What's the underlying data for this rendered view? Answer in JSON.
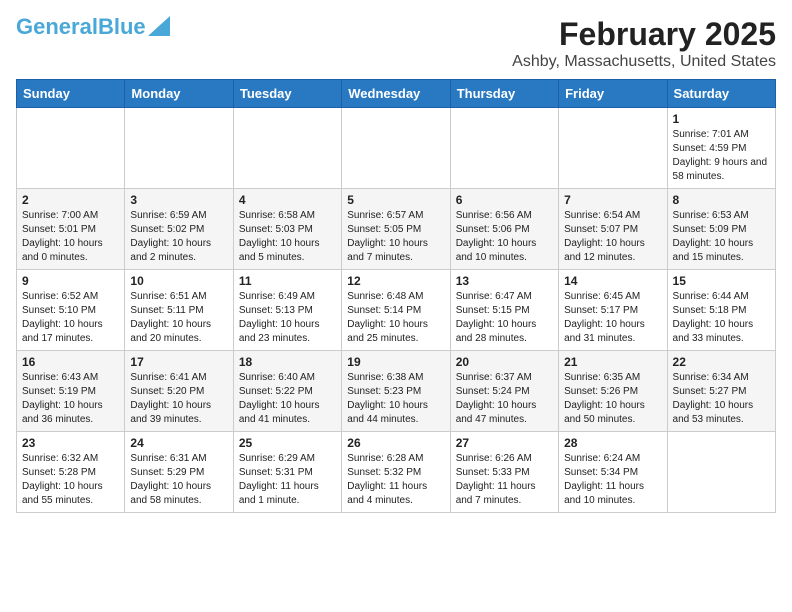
{
  "header": {
    "logo_line1": "General",
    "logo_line2": "Blue",
    "title": "February 2025",
    "subtitle": "Ashby, Massachusetts, United States"
  },
  "weekdays": [
    "Sunday",
    "Monday",
    "Tuesday",
    "Wednesday",
    "Thursday",
    "Friday",
    "Saturday"
  ],
  "weeks": [
    [
      {
        "day": "",
        "info": ""
      },
      {
        "day": "",
        "info": ""
      },
      {
        "day": "",
        "info": ""
      },
      {
        "day": "",
        "info": ""
      },
      {
        "day": "",
        "info": ""
      },
      {
        "day": "",
        "info": ""
      },
      {
        "day": "1",
        "info": "Sunrise: 7:01 AM\nSunset: 4:59 PM\nDaylight: 9 hours and 58 minutes."
      }
    ],
    [
      {
        "day": "2",
        "info": "Sunrise: 7:00 AM\nSunset: 5:01 PM\nDaylight: 10 hours and 0 minutes."
      },
      {
        "day": "3",
        "info": "Sunrise: 6:59 AM\nSunset: 5:02 PM\nDaylight: 10 hours and 2 minutes."
      },
      {
        "day": "4",
        "info": "Sunrise: 6:58 AM\nSunset: 5:03 PM\nDaylight: 10 hours and 5 minutes."
      },
      {
        "day": "5",
        "info": "Sunrise: 6:57 AM\nSunset: 5:05 PM\nDaylight: 10 hours and 7 minutes."
      },
      {
        "day": "6",
        "info": "Sunrise: 6:56 AM\nSunset: 5:06 PM\nDaylight: 10 hours and 10 minutes."
      },
      {
        "day": "7",
        "info": "Sunrise: 6:54 AM\nSunset: 5:07 PM\nDaylight: 10 hours and 12 minutes."
      },
      {
        "day": "8",
        "info": "Sunrise: 6:53 AM\nSunset: 5:09 PM\nDaylight: 10 hours and 15 minutes."
      }
    ],
    [
      {
        "day": "9",
        "info": "Sunrise: 6:52 AM\nSunset: 5:10 PM\nDaylight: 10 hours and 17 minutes."
      },
      {
        "day": "10",
        "info": "Sunrise: 6:51 AM\nSunset: 5:11 PM\nDaylight: 10 hours and 20 minutes."
      },
      {
        "day": "11",
        "info": "Sunrise: 6:49 AM\nSunset: 5:13 PM\nDaylight: 10 hours and 23 minutes."
      },
      {
        "day": "12",
        "info": "Sunrise: 6:48 AM\nSunset: 5:14 PM\nDaylight: 10 hours and 25 minutes."
      },
      {
        "day": "13",
        "info": "Sunrise: 6:47 AM\nSunset: 5:15 PM\nDaylight: 10 hours and 28 minutes."
      },
      {
        "day": "14",
        "info": "Sunrise: 6:45 AM\nSunset: 5:17 PM\nDaylight: 10 hours and 31 minutes."
      },
      {
        "day": "15",
        "info": "Sunrise: 6:44 AM\nSunset: 5:18 PM\nDaylight: 10 hours and 33 minutes."
      }
    ],
    [
      {
        "day": "16",
        "info": "Sunrise: 6:43 AM\nSunset: 5:19 PM\nDaylight: 10 hours and 36 minutes."
      },
      {
        "day": "17",
        "info": "Sunrise: 6:41 AM\nSunset: 5:20 PM\nDaylight: 10 hours and 39 minutes."
      },
      {
        "day": "18",
        "info": "Sunrise: 6:40 AM\nSunset: 5:22 PM\nDaylight: 10 hours and 41 minutes."
      },
      {
        "day": "19",
        "info": "Sunrise: 6:38 AM\nSunset: 5:23 PM\nDaylight: 10 hours and 44 minutes."
      },
      {
        "day": "20",
        "info": "Sunrise: 6:37 AM\nSunset: 5:24 PM\nDaylight: 10 hours and 47 minutes."
      },
      {
        "day": "21",
        "info": "Sunrise: 6:35 AM\nSunset: 5:26 PM\nDaylight: 10 hours and 50 minutes."
      },
      {
        "day": "22",
        "info": "Sunrise: 6:34 AM\nSunset: 5:27 PM\nDaylight: 10 hours and 53 minutes."
      }
    ],
    [
      {
        "day": "23",
        "info": "Sunrise: 6:32 AM\nSunset: 5:28 PM\nDaylight: 10 hours and 55 minutes."
      },
      {
        "day": "24",
        "info": "Sunrise: 6:31 AM\nSunset: 5:29 PM\nDaylight: 10 hours and 58 minutes."
      },
      {
        "day": "25",
        "info": "Sunrise: 6:29 AM\nSunset: 5:31 PM\nDaylight: 11 hours and 1 minute."
      },
      {
        "day": "26",
        "info": "Sunrise: 6:28 AM\nSunset: 5:32 PM\nDaylight: 11 hours and 4 minutes."
      },
      {
        "day": "27",
        "info": "Sunrise: 6:26 AM\nSunset: 5:33 PM\nDaylight: 11 hours and 7 minutes."
      },
      {
        "day": "28",
        "info": "Sunrise: 6:24 AM\nSunset: 5:34 PM\nDaylight: 11 hours and 10 minutes."
      },
      {
        "day": "",
        "info": ""
      }
    ]
  ]
}
